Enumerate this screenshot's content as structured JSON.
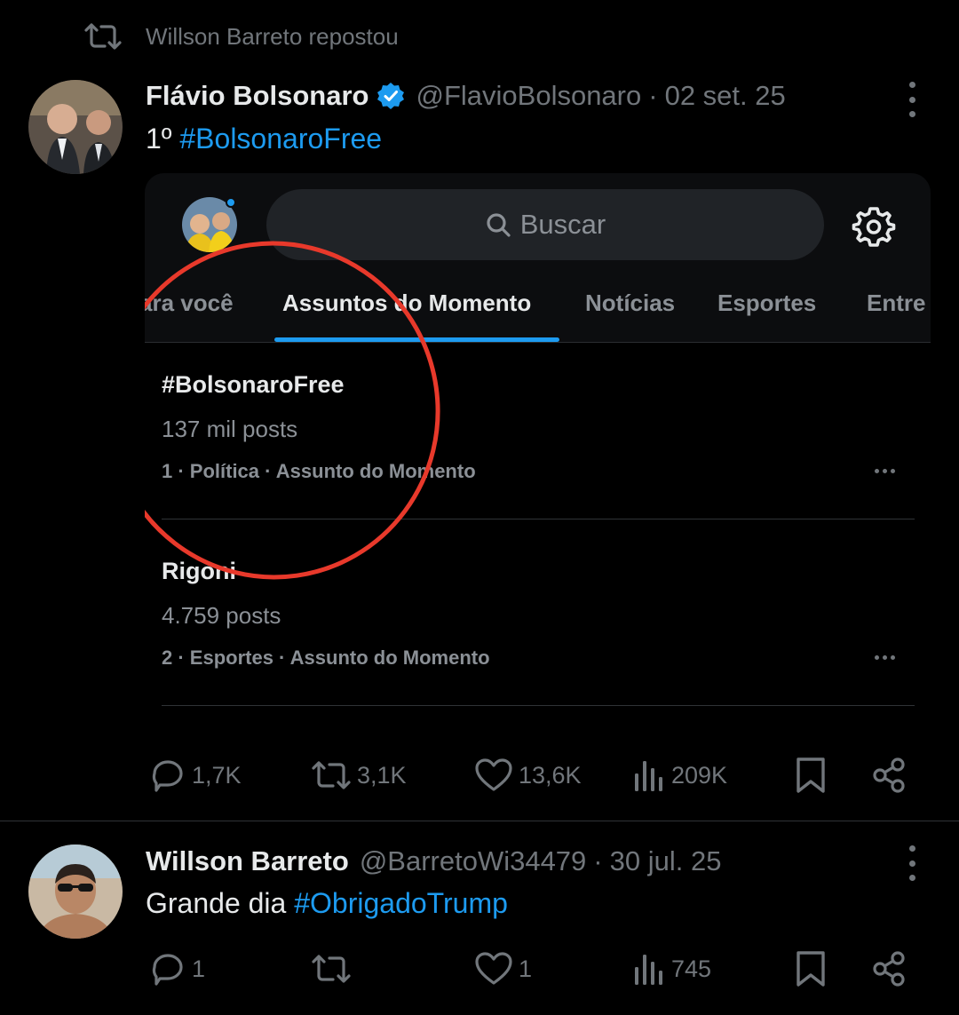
{
  "repost": {
    "text": "Willson Barreto repostou"
  },
  "post1": {
    "author_name": "Flávio Bolsonaro",
    "handle": "@FlavioBolsonaro",
    "separator": "·",
    "date": "02 set. 25",
    "text_prefix": "1º ",
    "hashtag": "#BolsonaroFree",
    "embed": {
      "search_placeholder": "Buscar",
      "tabs": [
        "ara você",
        "Assuntos do Momento",
        "Notícias",
        "Esportes",
        "Entre"
      ],
      "active_tab": "Assuntos do Momento",
      "trends": [
        {
          "title": "#BolsonaroFree",
          "count": "137 mil posts",
          "meta": "1 · Política · Assunto do Momento"
        },
        {
          "title": "Rigoni",
          "count": "4.759 posts",
          "meta": "2 · Esportes · Assunto do Momento"
        }
      ],
      "annotation_color": "#e8392b"
    },
    "actions": {
      "replies": "1,7K",
      "reposts": "3,1K",
      "likes": "13,6K",
      "views": "209K"
    }
  },
  "post2": {
    "author_name": "Willson Barreto",
    "handle": "@BarretoWi34479",
    "separator": "·",
    "date": "30 jul. 25",
    "text_prefix": "Grande dia ",
    "hashtag": "#ObrigadoTrump",
    "actions": {
      "replies": "1",
      "reposts": "",
      "likes": "1",
      "views": "745"
    }
  },
  "colors": {
    "background": "#000000",
    "accent": "#1d9bf0",
    "muted": "#71767b",
    "text": "#e7e9ea"
  },
  "icons": [
    "repost-icon",
    "verified-icon",
    "more-vertical-icon",
    "search-icon",
    "gear-icon",
    "reply-icon",
    "like-icon",
    "views-icon",
    "bookmark-icon",
    "share-icon"
  ]
}
